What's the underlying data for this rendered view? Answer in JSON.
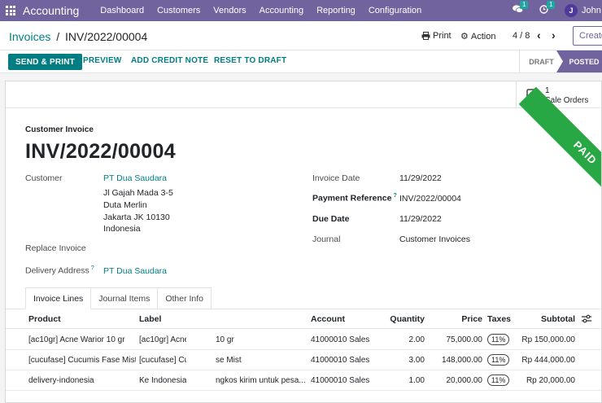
{
  "navbar": {
    "app_name": "Accounting",
    "menu": [
      "Dashboard",
      "Customers",
      "Vendors",
      "Accounting",
      "Reporting",
      "Configuration"
    ],
    "messages_count": "1",
    "activities_count": "1",
    "user_initial": "J",
    "user_name": "John D"
  },
  "control_panel": {
    "breadcrumb_parent": "Invoices",
    "breadcrumb_sep": "/",
    "breadcrumb_current": "INV/2022/00004",
    "print_label": "Print",
    "action_label": "Action",
    "pager": "4 / 8",
    "create_label": "Create"
  },
  "statusbar": {
    "send_print": "SEND & PRINT",
    "preview": "PREVIEW",
    "add_credit_note": "ADD CREDIT NOTE",
    "reset_to_draft": "RESET TO DRAFT",
    "stages": [
      "DRAFT",
      "POSTED"
    ],
    "active_stage": "POSTED"
  },
  "smart_button": {
    "count": "1",
    "label": "Sale Orders"
  },
  "ribbon": "PAID",
  "invoice": {
    "type": "Customer Invoice",
    "name": "INV/2022/00004",
    "customer_label": "Customer",
    "customer": "PT Dua Saudara",
    "address": [
      "Jl Gajah Mada 3-5",
      "Duta Merlin",
      "Jakarta JK 10130",
      "Indonesia"
    ],
    "replace_invoice_label": "Replace Invoice",
    "delivery_address_label": "Delivery Address",
    "delivery_address": "PT Dua Saudara",
    "invoice_date_label": "Invoice Date",
    "invoice_date": "11/29/2022",
    "payment_reference_label": "Payment Reference",
    "payment_reference": "INV/2022/00004",
    "due_date_label": "Due Date",
    "due_date": "11/29/2022",
    "journal_label": "Journal",
    "journal": "Customer Invoices"
  },
  "tabs": [
    "Invoice Lines",
    "Journal Items",
    "Other Info"
  ],
  "table": {
    "headers": {
      "product": "Product",
      "label": "Label",
      "account": "Account",
      "quantity": "Quantity",
      "price": "Price",
      "taxes": "Taxes",
      "subtotal": "Subtotal"
    },
    "rows": [
      {
        "product": "[ac10gr] Acne Warior 10 gr",
        "label_a": "[ac10gr] Acne",
        "label_b": "10 gr",
        "account": "41000010 Sales",
        "quantity": "2.00",
        "price": "75,000.00",
        "tax": "11%",
        "subtotal": "Rp 150,000.00"
      },
      {
        "product": "[cucufase] Cucumis Fase Mist",
        "label_a": "[cucufase] Cu",
        "label_b": "se Mist",
        "account": "41000010 Sales",
        "quantity": "3.00",
        "price": "148,000.00",
        "tax": "11%",
        "subtotal": "Rp 444,000.00"
      },
      {
        "product": "delivery-indonesia",
        "label_a": "Ke Indonesia",
        "label_b": "ngkos kirim untuk pesa...",
        "account": "41000010 Sales",
        "quantity": "1.00",
        "price": "20,000.00",
        "tax": "11%",
        "subtotal": "Rp 20,000.00"
      }
    ]
  },
  "colors": {
    "brand": "#71639e",
    "primary": "#017e84",
    "paid_ribbon": "#28a745"
  },
  "icons": [
    "apps-grid-icon",
    "chat-icon",
    "clock-icon",
    "printer-icon",
    "gear-icon",
    "chevron-left-icon",
    "chevron-right-icon",
    "edit-square-icon",
    "optional-columns-icon"
  ]
}
